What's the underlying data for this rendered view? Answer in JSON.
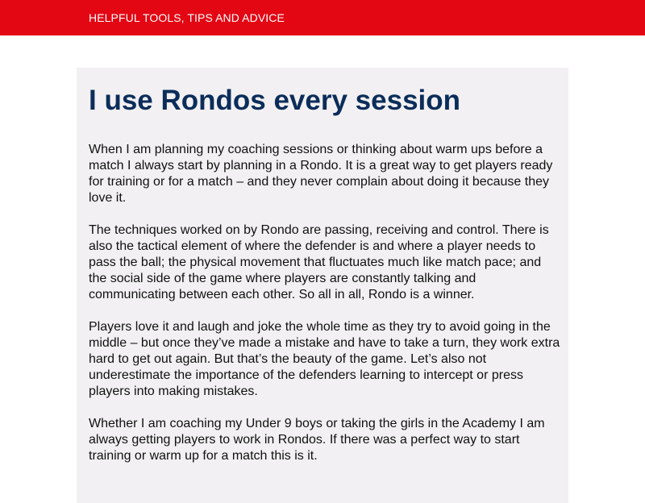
{
  "header": {
    "tagline": "HELPFUL TOOLS, TIPS AND ADVICE",
    "background_color": "#e30613"
  },
  "article": {
    "title": "I use Rondos every session",
    "title_color": "#0b2d5a",
    "background_color": "#f2f0f2",
    "paragraphs": [
      "When I am planning my coaching sessions or thinking about warm ups before a match I always start by planning in a Rondo. It is a great way to get players ready for training or for a match – and they never complain about doing it because they love it.",
      "The techniques worked on by Rondo are passing, receiving and control. There is also the tactical element of where the defender is and where a player needs to pass the ball; the physical movement that fluctuates much like match pace; and the social side of the game where players are constantly talking and communicating between each other. So all in all, Rondo is a winner.",
      "Players love it and laugh and joke the whole time as they try to avoid going in the middle – but once they’ve made a mistake and have to take a turn, they work extra hard to get out again. But that’s the beauty of the game. Let’s also not underestimate the importance of the defenders learning to intercept or press players into making mistakes.",
      "Whether I am coaching my Under 9 boys or taking the girls in the Academy I am always getting players to work in Rondos. If there was a perfect way to start training or warm up for a match this is it."
    ]
  }
}
